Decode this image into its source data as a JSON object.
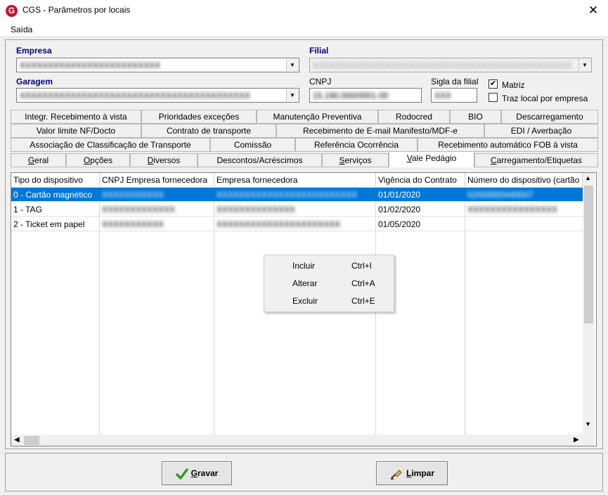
{
  "window": {
    "title": "CGS - Parâmetros por locais",
    "close": "✕",
    "icon_letter": "G"
  },
  "menu": {
    "saida": "Saída"
  },
  "form": {
    "empresa_label": "Empresa",
    "empresa_value": "XXXXXXXXXXXXXXXXXXXXXXXXX",
    "filial_label": "Filial",
    "filial_value": "XXXXXXXXXXXXXXXXXXXXXXXXXXXXXXXXXXXXXXXXXXXXXX",
    "garagem_label": "Garagem",
    "garagem_value": "XXXXXXXXXXXXXXXXXXXXXXXXXXXXXXXXXXXXXXXXX",
    "cnpj_label": "CNPJ",
    "cnpj_value": "15.190.000/0001-00",
    "sigla_label": "Sigla da filial",
    "sigla_value": "XXX",
    "matriz_label": "Matriz",
    "matriz_checked": "✔",
    "traz_label": "Traz local por empresa"
  },
  "tabs": {
    "row1": [
      "Integr. Recebimento à vista",
      "Prioridades exceções",
      "Manutenção Preventiva",
      "Rodocred",
      "BIO",
      "Descarregamento"
    ],
    "row2": [
      "Valor limite NF/Docto",
      "Contrato de transporte",
      "Recebimento de E-mail Manifesto/MDF-e",
      "EDI / Averbação"
    ],
    "row3": [
      "Associação de Classificação de Transporte",
      "Comissão",
      "Referência Ocorrência",
      "Recebimento automático FOB à vista"
    ],
    "row4": [
      "Geral",
      "Opções",
      "Diversos",
      "Descontos/Acréscimos",
      "Serviços",
      "Vale Pedágio",
      "Carregamento/Etiquetas"
    ],
    "row4_underline": [
      "G",
      "O",
      "D",
      "",
      "S",
      "V",
      "C"
    ],
    "active": "Vale Pedágio"
  },
  "grid": {
    "columns": [
      "Tipo do dispositivo",
      "CNPJ Empresa fornecedora",
      "Empresa fornecedora",
      "Vigência do Contrato",
      "Número do dispositivo (cartão"
    ],
    "rows": [
      {
        "tipo": "0 - Cartão magnético",
        "cnpj": "XXXXXXXXXXX",
        "empresa": "XXXXXXXXXXXXXXXXXXXXXXXXX",
        "vigencia": "01/01/2020",
        "numero": "52000000440007"
      },
      {
        "tipo": "1 - TAG",
        "cnpj": "XXXXXXXXXXXXX",
        "empresa": "XXXXXXXXXXXXXX",
        "vigencia": "01/02/2020",
        "numero": "XXXXXXXXXXXXXXXX"
      },
      {
        "tipo": "2 - Ticket em papel",
        "cnpj": "XXXXXXXXXXX",
        "empresa": "XXXXXXXXXXXXXXXXXXXXXX",
        "vigencia": "01/05/2020",
        "numero": ""
      }
    ]
  },
  "context_menu": [
    {
      "label": "Incluir",
      "shortcut": "Ctrl+I"
    },
    {
      "label": "Alterar",
      "shortcut": "Ctrl+A"
    },
    {
      "label": "Excluir",
      "shortcut": "Ctrl+E"
    }
  ],
  "buttons": {
    "gravar_u": "G",
    "gravar_rest": "ravar",
    "limpar_u": "L",
    "limpar_rest": "impar"
  },
  "colors": {
    "selection": "#0078d7",
    "label_blue": "#000080",
    "check_green": "#2e9a2e"
  }
}
